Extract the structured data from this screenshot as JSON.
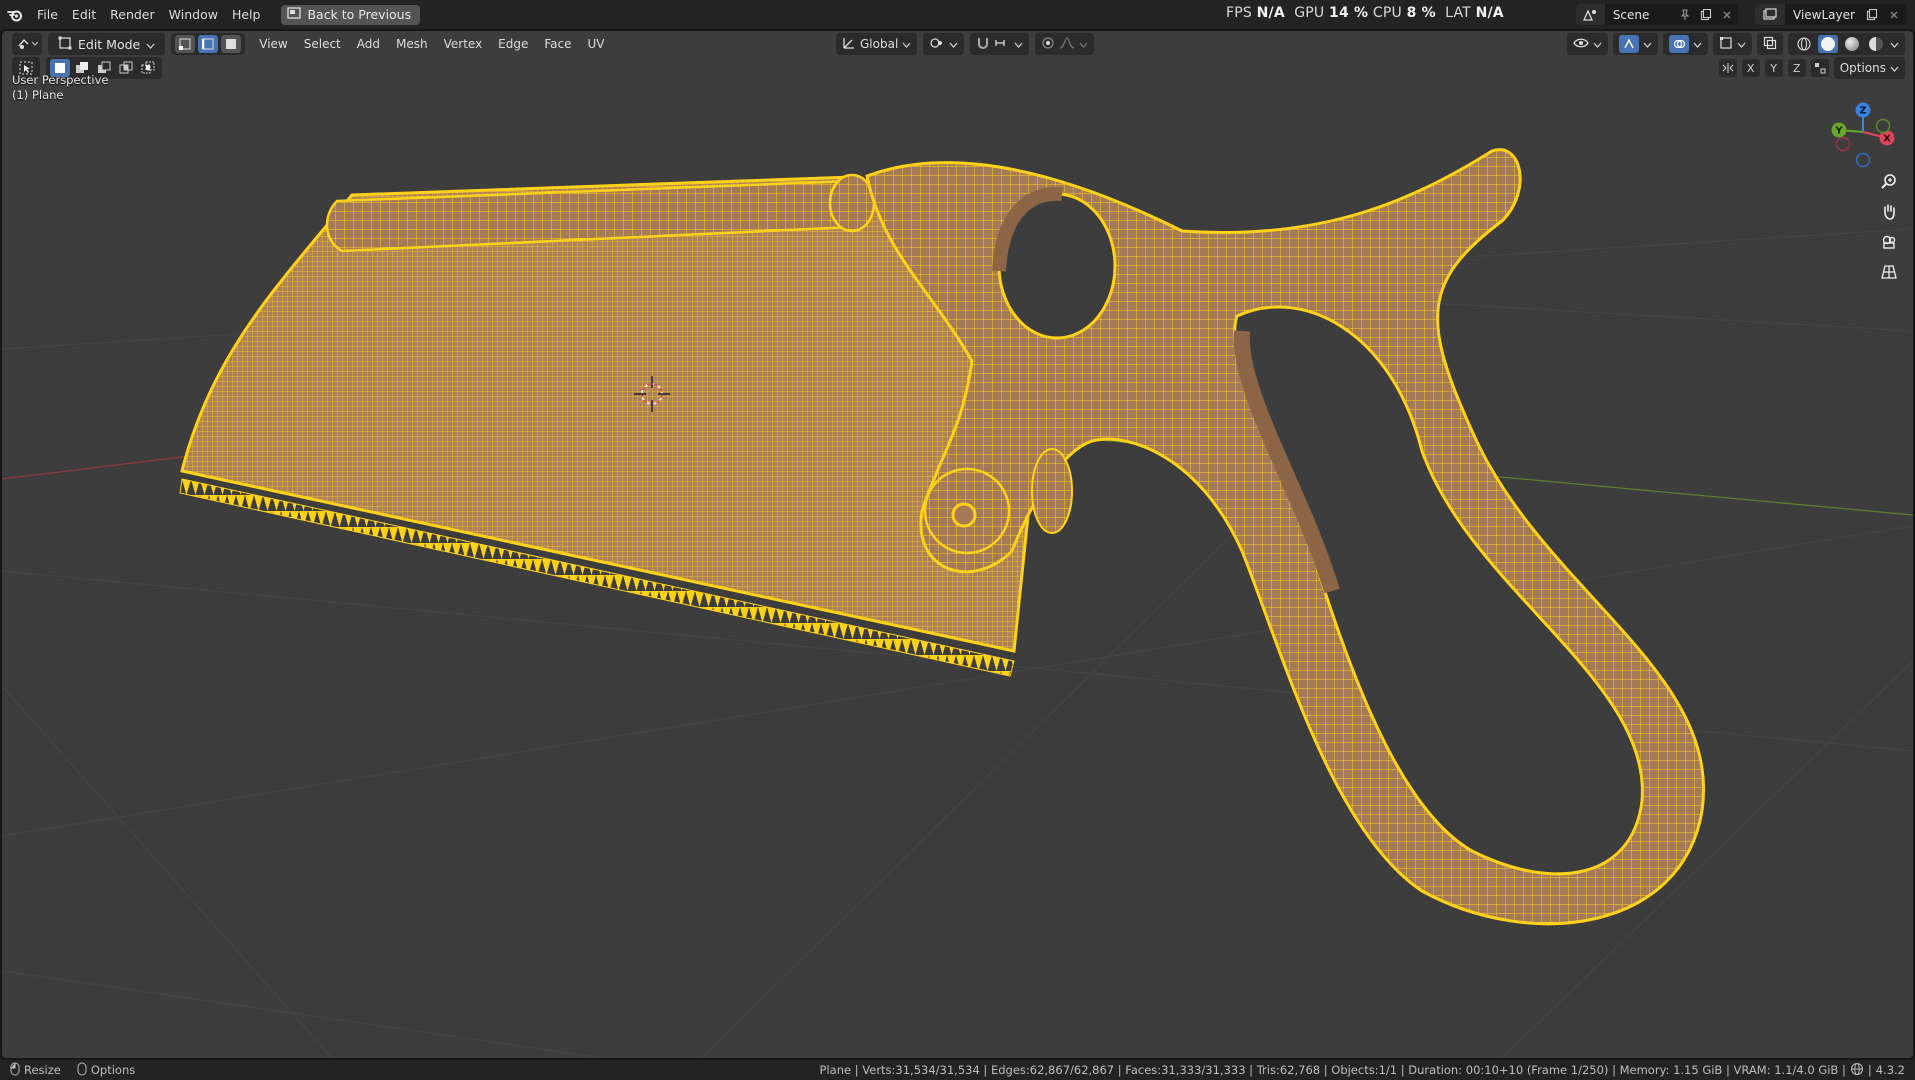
{
  "menubar": {
    "items": [
      "File",
      "Edit",
      "Render",
      "Window",
      "Help"
    ],
    "back_button": "Back to Previous"
  },
  "perf": {
    "fps_label": "FPS",
    "fps_value": "N/A",
    "gpu_label": "GPU",
    "gpu_value": "14 %",
    "cpu_label": "CPU",
    "cpu_value": "8 %",
    "lat_label": "LAT",
    "lat_value": "N/A"
  },
  "scene": {
    "name": "Scene"
  },
  "view_layer": {
    "name": "ViewLayer"
  },
  "viewport_header": {
    "mode": "Edit Mode",
    "menus": [
      "View",
      "Select",
      "Add",
      "Mesh",
      "Vertex",
      "Edge",
      "Face",
      "UV"
    ],
    "orientation": "Global",
    "options_label": "Options",
    "axes": [
      "X",
      "Y",
      "Z"
    ]
  },
  "viewport": {
    "view_name": "User Perspective",
    "object_name": "(1) Plane",
    "gizmo_axes": [
      "Z",
      "Y",
      "X"
    ]
  },
  "statusbar": {
    "left_items": [
      "Resize",
      "Options"
    ],
    "stats": "Plane | Verts:31,534/31,534 | Edges:62,867/62,867 | Faces:31,333/31,333 | Tris:62,768 | Objects:1/1 | Duration: 00:10+10 (Frame 1/250) | Memory: 1.15 GiB | VRAM: 1.1/4.0 GiB |",
    "version": "4.3.2"
  },
  "colors": {
    "accent": "#4772b3",
    "mesh_wire": "#ffd21a",
    "mesh_face": "#a57b57",
    "viewport_bg": "#3d3d3d",
    "axis_x": "#e0445a",
    "axis_y": "#6aa52e",
    "axis_z": "#3b82e0"
  }
}
